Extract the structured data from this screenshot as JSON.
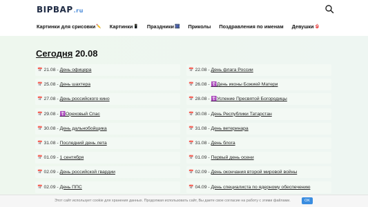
{
  "header": {
    "logo_text": "BIPBAP",
    "logo_tld": ".ru",
    "nav": [
      {
        "label": "Картинки для срисовки",
        "emoji": "✏️"
      },
      {
        "label": "Картинки",
        "emoji": "📱"
      },
      {
        "label": "Праздники",
        "emoji": "🎆"
      },
      {
        "label": "Приколы",
        "emoji": ""
      },
      {
        "label": "Поздравления по именам",
        "emoji": ""
      },
      {
        "label": "Девушки",
        "emoji": "👙"
      }
    ]
  },
  "main": {
    "title_prefix": "Сегодня",
    "title_date": "20.08",
    "left": [
      {
        "date": "21.08 -",
        "text": "День офицера"
      },
      {
        "date": "25.08 -",
        "text": "День шахтера"
      },
      {
        "date": "27.08 -",
        "text": "День российского кино"
      },
      {
        "date": "29.08 -",
        "text": "☦️Ореховый Спас"
      },
      {
        "date": "30.08 -",
        "text": "День дальнобойщика"
      },
      {
        "date": "31.08 -",
        "text": "Последний день лета"
      },
      {
        "date": "01.09 -",
        "text": "1 сентября"
      },
      {
        "date": "02.09 -",
        "text": "День российской гвардии"
      },
      {
        "date": "02.09 -",
        "text": "День ППС"
      }
    ],
    "right": [
      {
        "date": "22.08 -",
        "text": "День флага России"
      },
      {
        "date": "26.08 -",
        "text": "☦️День иконы Божией Матери"
      },
      {
        "date": "28.08 -",
        "text": "☦️Успение Пресвятой Богородицы"
      },
      {
        "date": "30.08 -",
        "text": "День Республики Татарстан"
      },
      {
        "date": "31.08 -",
        "text": "День ветеринара"
      },
      {
        "date": "31.08 -",
        "text": "День блога"
      },
      {
        "date": "01.09 -",
        "text": "Первый день осени"
      },
      {
        "date": "02.09 -",
        "text": "День окончания второй мировой войны"
      },
      {
        "date": "04.09 -",
        "text": "День специалиста по ядерному обеспечению"
      }
    ]
  },
  "cookie": {
    "text": "Этот сайт использует cookie для хранения данных. Продолжая использовать сайт, Вы даете свое согласие на работу с этими файлами.",
    "ok_label": "OK"
  }
}
